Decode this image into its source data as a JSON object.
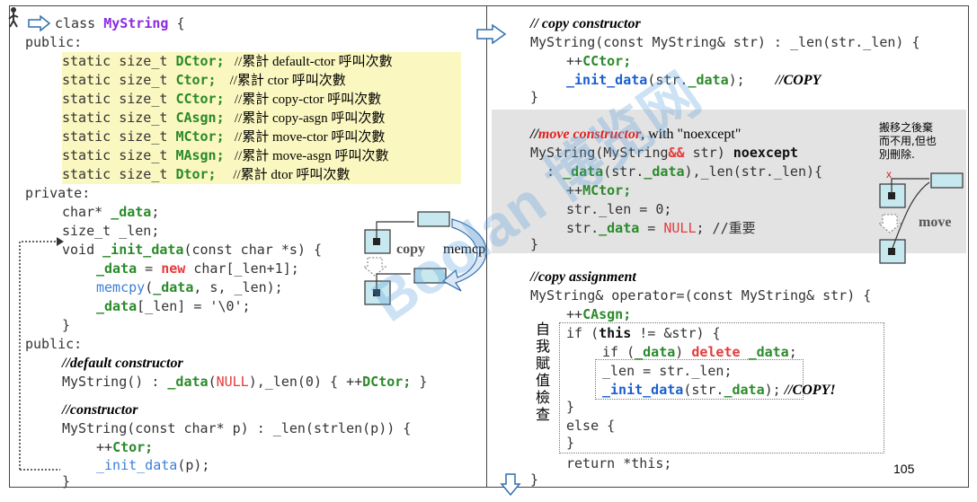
{
  "left": {
    "l1": {
      "a": "class ",
      "b": "MyString",
      "c": " {"
    },
    "l2": "public:",
    "statics": [
      {
        "a": "static size_t ",
        "b": "DCtor;",
        "c": "   //累計 default-ctor 呼叫次數"
      },
      {
        "a": "static size_t ",
        "b": "Ctor;",
        "c": "    //累計 ctor 呼叫次數"
      },
      {
        "a": "static size_t ",
        "b": "CCtor;",
        "c": "   //累計 copy-ctor 呼叫次數"
      },
      {
        "a": "static size_t ",
        "b": "CAsgn;",
        "c": "   //累計 copy-asgn 呼叫次數"
      },
      {
        "a": "static size_t ",
        "b": "MCtor;",
        "c": "   //累計 move-ctor 呼叫次數"
      },
      {
        "a": "static size_t ",
        "b": "MAsgn;",
        "c": "   //累計 move-asgn 呼叫次數"
      },
      {
        "a": "static size_t ",
        "b": "Dtor;",
        "c": "     //累計 dtor 呼叫次數"
      }
    ],
    "private": "private:",
    "p1": {
      "a": "char* ",
      "b": "_data",
      "c": ";"
    },
    "p2": "size_t _len;",
    "init1": {
      "a": "void ",
      "b": "_init_data",
      "c": "(const char *s) {"
    },
    "init2": {
      "a": "_data",
      "b": " = ",
      "c": "new",
      "d": " char[_len+1];"
    },
    "init3": {
      "a": "memcpy",
      "b": "(",
      "c": "_data",
      "d": ", s, _len);"
    },
    "init4": {
      "a": "_data",
      "b": "[_len] = '\\0';"
    },
    "init5": "}",
    "public2": "public:",
    "dc_cmt": "//default constructor",
    "dc": {
      "a": "MyString() : ",
      "b": "_data",
      "c": "(",
      "d": "NULL",
      "e": "),_len(0) { ++",
      "f": "DCtor;",
      "g": " }"
    },
    "c_cmt": "//constructor",
    "c1": "MyString(const char* p) : _len(strlen(p)) {",
    "c2": {
      "a": "++",
      "b": "Ctor;"
    },
    "c3": {
      "a": "_init_data",
      "b": "(p);"
    },
    "c4": "}"
  },
  "right": {
    "cc_cmt": "// copy constructor",
    "cc1": "MyString(const MyString& str) : _len(str._len) {",
    "cc2": {
      "a": "++",
      "b": "CCtor;"
    },
    "cc3": {
      "a": "_init_data",
      "b": "(str.",
      "c": "_data",
      "d": ");",
      "e": "//COPY"
    },
    "cc4": "}",
    "mc_cmt": {
      "a": "//",
      "b": "move constructor",
      "c": ", with \"noexcept\""
    },
    "mc1": {
      "a": "MyString(MyString",
      "b": "&&",
      "c": " str) ",
      "d": "noexcept"
    },
    "mc2": {
      "a": ": ",
      "b": "_data",
      "c": "(str.",
      "d": "_data",
      "e": "),_len(str._len){"
    },
    "mc3": {
      "a": "++",
      "b": "MCtor;"
    },
    "mc4": "str._len = 0;",
    "mc5": {
      "a": "str.",
      "b": "_data",
      "c": " = ",
      "d": "NULL",
      "e": "; //重要"
    },
    "mc6": "}",
    "note": [
      "搬移之後棄",
      "而不用,但也",
      "別刪除."
    ],
    "move_label": "move",
    "ca_cmt": "//copy assignment",
    "ca1": "MyString& operator=(const MyString& str) {",
    "ca2": {
      "a": "++",
      "b": "CAsgn;"
    },
    "ca3": {
      "a": "if (",
      "b": "this",
      "c": " != &str) {"
    },
    "ca4": {
      "a": "if (",
      "b": "_data",
      "c": ") ",
      "d": "delete",
      "e": " ",
      "f": "_data",
      "g": ";"
    },
    "ca5": "_len = str._len;",
    "ca6": {
      "a": "_init_data",
      "b": "(str.",
      "c": "_data",
      "d": ");",
      "e": " //COPY!"
    },
    "ca7": "}",
    "ca8": "else {",
    "ca9": "}",
    "ca10": "return *this;",
    "ca11": "}",
    "side": [
      "自",
      "我",
      "賦",
      "值",
      "檢",
      "查"
    ],
    "page": "105"
  },
  "diagram": {
    "copy": "copy",
    "memcpy": "memcpy()"
  },
  "watermark": "Boolan 博览网"
}
